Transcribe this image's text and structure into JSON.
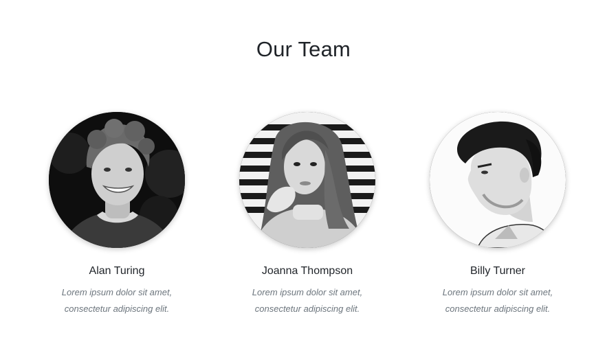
{
  "section": {
    "title": "Our Team"
  },
  "team": [
    {
      "name": "Alan Turing",
      "bio": "Lorem ipsum dolor sit amet, consectetur adipiscing elit.",
      "photo": "avatar-photo-man-smiling"
    },
    {
      "name": "Joanna Thompson",
      "bio": "Lorem ipsum dolor sit amet, consectetur adipiscing elit.",
      "photo": "avatar-photo-woman-striped-background"
    },
    {
      "name": "Billy Turner",
      "bio": "Lorem ipsum dolor sit amet, consectetur adipiscing elit.",
      "photo": "avatar-photo-man-profile"
    }
  ],
  "colors": {
    "heading": "#1f2328",
    "muted_text": "#6c757d",
    "background": "#ffffff"
  }
}
